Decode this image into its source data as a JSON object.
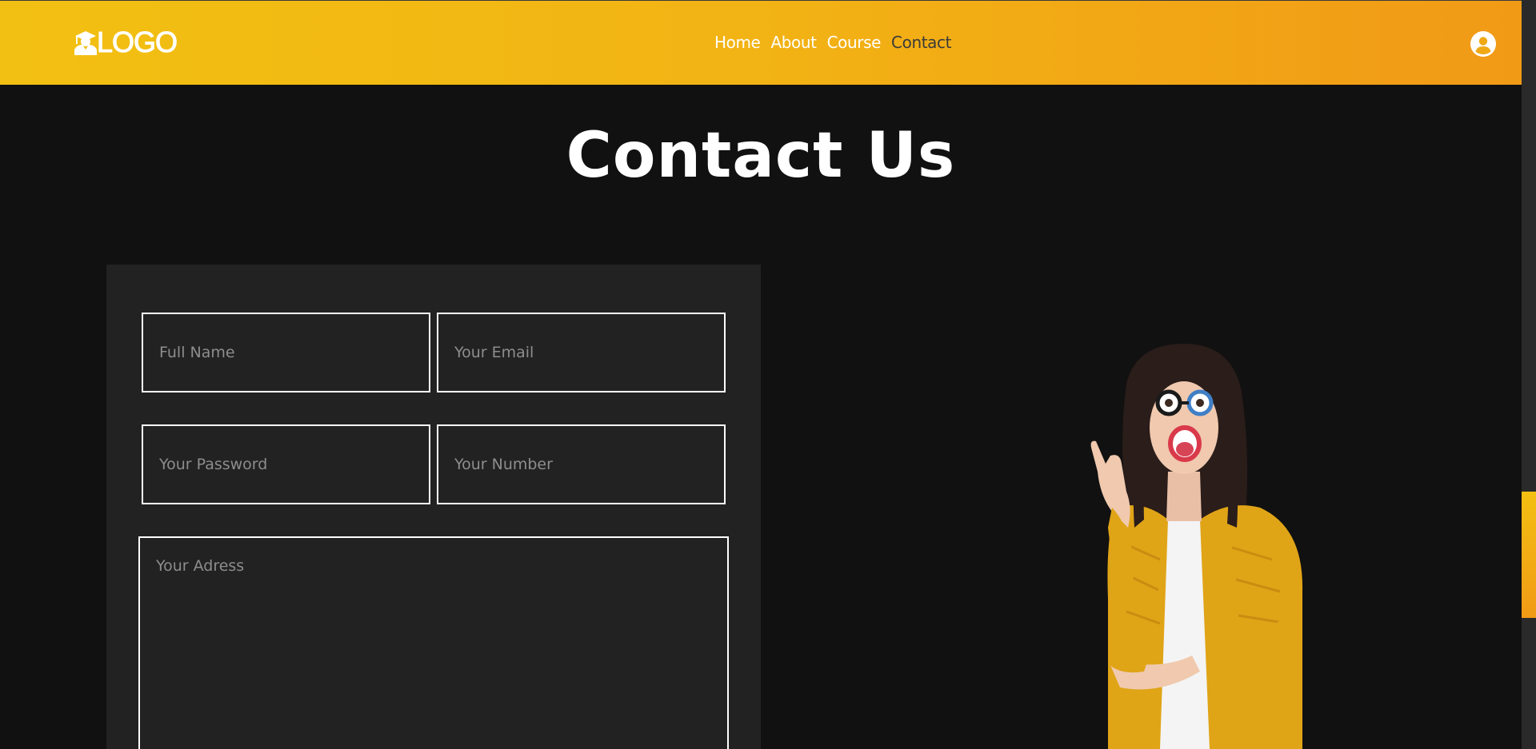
{
  "header": {
    "logo_text": "LOGO",
    "nav": [
      {
        "label": "Home",
        "active": false
      },
      {
        "label": "About",
        "active": false
      },
      {
        "label": "Course",
        "active": false
      },
      {
        "label": "Contact",
        "active": true
      }
    ],
    "icons": {
      "logo": "graduate-icon",
      "user": "user-circle-icon"
    }
  },
  "main": {
    "title": "Contact Us",
    "form": {
      "full_name_placeholder": "Full Name",
      "email_placeholder": "Your Email",
      "password_placeholder": "Your Password",
      "number_placeholder": "Your Number",
      "address_placeholder": "Your Adress"
    }
  },
  "colors": {
    "accent_start": "#f2c012",
    "accent_end": "#f19a16",
    "background": "#111111",
    "panel": "#222222"
  }
}
